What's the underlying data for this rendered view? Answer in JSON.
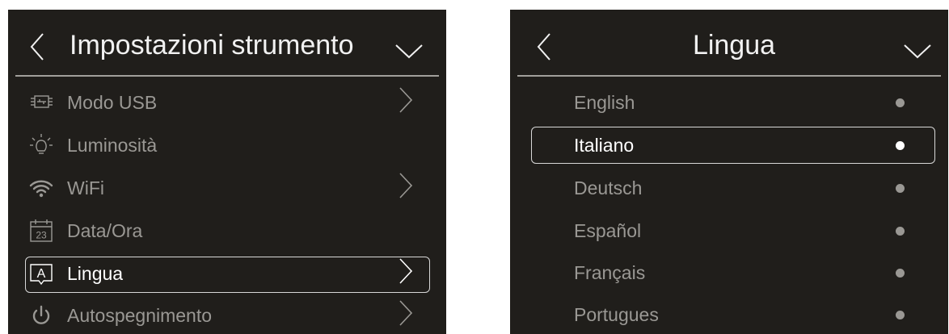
{
  "colors": {
    "screen_bg": "#201e1b",
    "text_inactive": "#9a9894",
    "text_active": "#ffffff",
    "divider": "#a19f9b",
    "selection_border": "#d8d8d8"
  },
  "settings_menu": {
    "title": "Impostazioni strumento",
    "items": [
      {
        "icon": "usb-mode-icon",
        "label": "Modo USB",
        "has_submenu": true,
        "selected": false
      },
      {
        "icon": "brightness-icon",
        "label": "Luminosità",
        "has_submenu": false,
        "selected": false
      },
      {
        "icon": "wifi-icon",
        "label": "WiFi",
        "has_submenu": true,
        "selected": false
      },
      {
        "icon": "calendar-icon",
        "calendar_day": "23",
        "label": "Data/Ora",
        "has_submenu": false,
        "selected": false
      },
      {
        "icon": "language-icon",
        "icon_letter": "A",
        "label": "Lingua",
        "has_submenu": true,
        "selected": true
      },
      {
        "icon": "power-icon",
        "label": "Autospegnimento",
        "has_submenu": true,
        "selected": false
      }
    ]
  },
  "language_menu": {
    "title": "Lingua",
    "options": [
      {
        "label": "English",
        "selected": false
      },
      {
        "label": "Italiano",
        "selected": true
      },
      {
        "label": "Deutsch",
        "selected": false
      },
      {
        "label": "Español",
        "selected": false
      },
      {
        "label": "Français",
        "selected": false
      },
      {
        "label": "Portugues",
        "selected": false
      }
    ]
  }
}
